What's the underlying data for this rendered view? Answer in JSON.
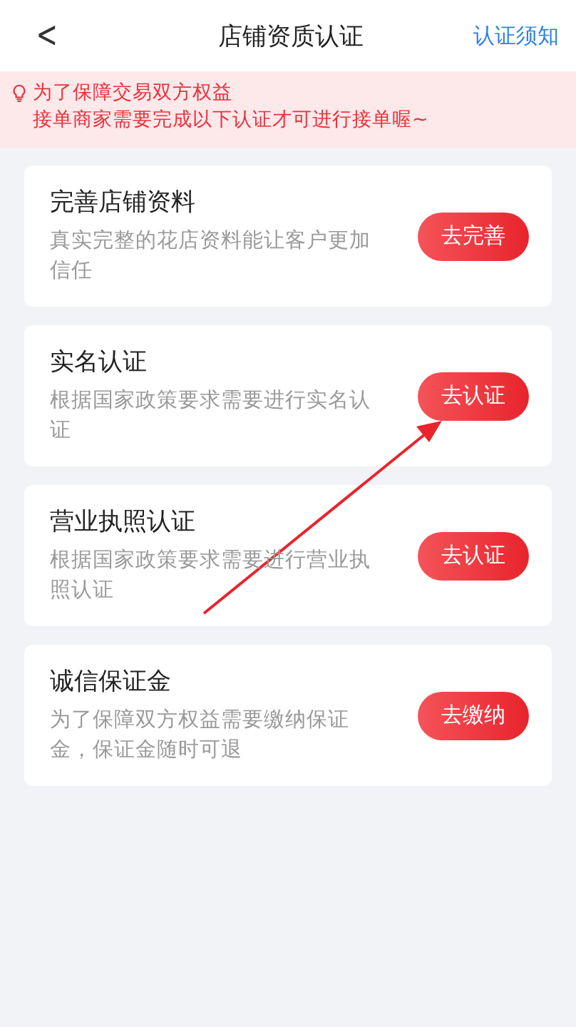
{
  "nav": {
    "back": "<",
    "title": "店铺资质认证",
    "action": "认证须知"
  },
  "notice": {
    "lines": [
      "为了保障交易双方权益",
      "接单商家需要完成以下认证才可进行接单喔~"
    ]
  },
  "items": [
    {
      "title": "完善店铺资料",
      "desc": "真实完整的花店资料能让客户更加信任",
      "button": "去完善"
    },
    {
      "title": "实名认证",
      "desc": "根据国家政策要求需要进行实名认证",
      "button": "去认证"
    },
    {
      "title": "营业执照认证",
      "desc": "根据国家政策要求需要进行营业执照认证",
      "button": "去认证"
    },
    {
      "title": "诚信保证金",
      "desc": "为了保障双方权益需要缴纳保证金，保证金随时可退",
      "button": "去缴纳"
    }
  ]
}
